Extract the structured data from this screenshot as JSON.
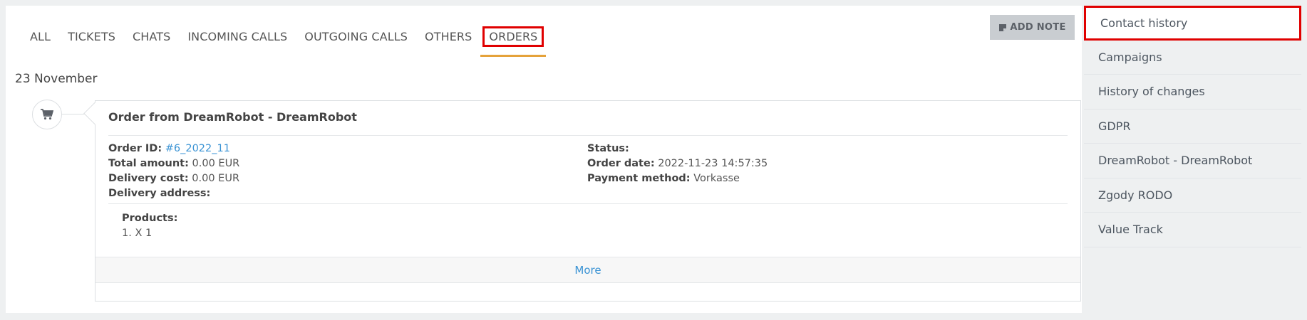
{
  "tabs": [
    "ALL",
    "TICKETS",
    "CHATS",
    "INCOMING CALLS",
    "OUTGOING CALLS",
    "OTHERS",
    "ORDERS"
  ],
  "active_tab": "ORDERS",
  "add_note_label": "ADD NOTE",
  "date_label": "23 November",
  "order": {
    "title": "Order from DreamRobot - DreamRobot",
    "order_id_label": "Order ID:",
    "order_id": "#6_2022_11",
    "total_amount_label": "Total amount:",
    "total_amount": "0.00 EUR",
    "delivery_cost_label": "Delivery cost:",
    "delivery_cost": "0.00 EUR",
    "delivery_address_label": "Delivery address:",
    "delivery_address": "",
    "status_label": "Status:",
    "status": "",
    "order_date_label": "Order date:",
    "order_date": "2022-11-23 14:57:35",
    "payment_method_label": "Payment method:",
    "payment_method": "Vorkasse",
    "products_label": "Products:",
    "products": [
      "1. X 1"
    ],
    "more_label": "More"
  },
  "sidebar": {
    "items": [
      "Contact history",
      "Campaigns",
      "History of changes",
      "GDPR",
      "DreamRobot - DreamRobot",
      "Zgody RODO",
      "Value Track"
    ],
    "active": "Contact history"
  },
  "icons": {
    "add_note": "note-icon",
    "timeline": "cart-icon"
  },
  "colors": {
    "accent_underline": "#e5a23a",
    "link": "#3a93d4",
    "highlight": "#e00000"
  }
}
